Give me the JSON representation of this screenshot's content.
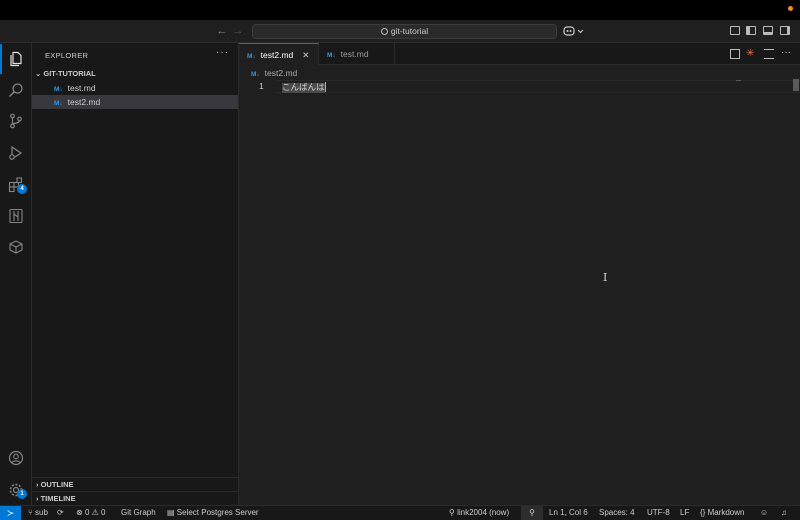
{
  "titlebar": {
    "search_text": "git-tutorial",
    "back_icon": "arrow-left-icon",
    "forward_icon": "arrow-right-icon",
    "copilot_icon": "copilot-icon"
  },
  "activity_bar": {
    "items": [
      {
        "name": "explorer",
        "icon": "files-icon"
      },
      {
        "name": "search",
        "icon": "search-icon"
      },
      {
        "name": "source-control",
        "icon": "source-control-icon"
      },
      {
        "name": "run-debug",
        "icon": "run-debug-icon"
      },
      {
        "name": "extensions",
        "icon": "extensions-icon",
        "badge": "4"
      },
      {
        "name": "git-graph",
        "icon": "git-graph-icon"
      },
      {
        "name": "database",
        "icon": "database-icon"
      }
    ],
    "accounts_icon": "account-icon",
    "settings_icon": "gear-icon",
    "settings_badge": "1"
  },
  "sidebar": {
    "header": "EXPLORER",
    "more": "···",
    "folder": "GIT-TUTORIAL",
    "files": [
      {
        "icon_text": "M↓",
        "label": "test.md",
        "selected": false
      },
      {
        "icon_text": "M↓",
        "label": "test2.md",
        "selected": true
      }
    ],
    "outline_label": "OUTLINE",
    "timeline_label": "TIMELINE"
  },
  "tabs": [
    {
      "icon_text": "M↓",
      "label": "test2.md",
      "active": true,
      "close": "✕"
    },
    {
      "icon_text": "M↓",
      "label": "test.md",
      "active": false
    }
  ],
  "breadcrumb": {
    "icon_text": "M↓",
    "label": "test2.md"
  },
  "editor": {
    "line_number": "1",
    "selected_text": "こんばんは"
  },
  "statusbar": {
    "remote_icon": "remote-icon",
    "branch": "sub",
    "errors": "0",
    "warnings": "0",
    "git_graph": "Git Graph",
    "postgres": "Select Postgres Server",
    "commit_info": "link2004 (now)",
    "position": "Ln 1, Col 6",
    "spaces": "Spaces: 4",
    "encoding": "UTF-8",
    "eol": "LF",
    "language": "Markdown"
  },
  "colors": {
    "accent": "#0078d4",
    "background": "#1f1f1f",
    "sidebar": "#181818",
    "markdown_icon": "#3a96dd"
  }
}
